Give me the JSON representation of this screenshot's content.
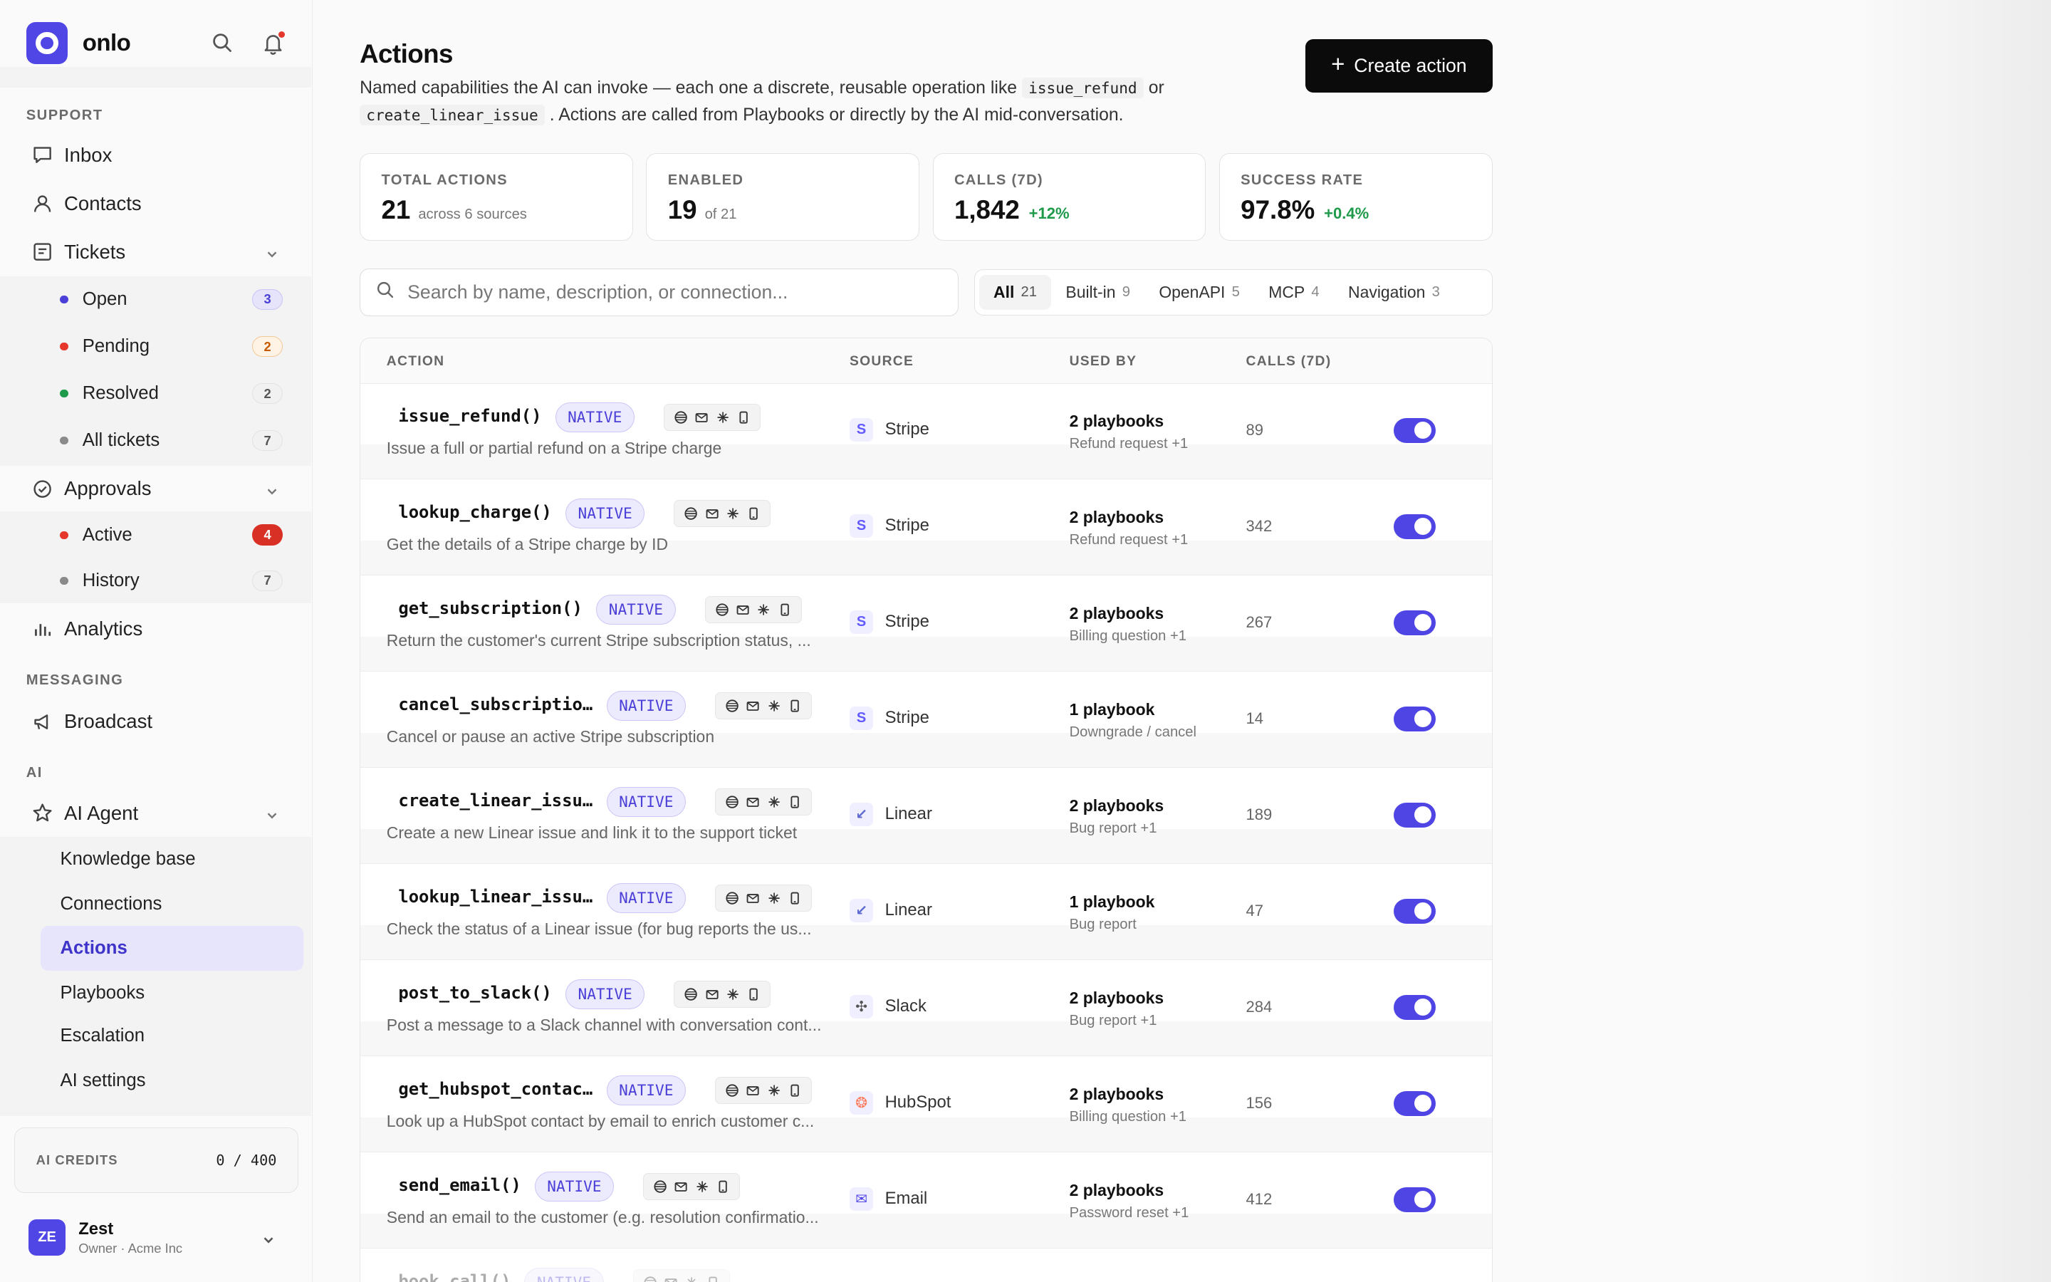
{
  "app": {
    "name": "onlo"
  },
  "sidebar": {
    "sections": {
      "support": "SUPPORT",
      "messaging": "MESSAGING",
      "ai": "AI"
    },
    "inbox": "Inbox",
    "contacts": "Contacts",
    "tickets": {
      "label": "Tickets",
      "items": [
        {
          "label": "Open",
          "count": "3",
          "dot": "#4a3fd6"
        },
        {
          "label": "Pending",
          "count": "2",
          "dot": "#e5372b"
        },
        {
          "label": "Resolved",
          "count": "2",
          "dot": "#1e9a4a"
        },
        {
          "label": "All tickets",
          "count": "7",
          "dot": "#8a8a8a"
        }
      ]
    },
    "approvals": {
      "label": "Approvals",
      "items": [
        {
          "label": "Active",
          "count": "4",
          "dot": "#e5372b"
        },
        {
          "label": "History",
          "count": "7",
          "dot": "#8a8a8a"
        }
      ]
    },
    "analytics": "Analytics",
    "broadcast": "Broadcast",
    "ai_agent": {
      "label": "AI Agent",
      "items": [
        "Knowledge base",
        "Connections",
        "Actions",
        "Playbooks",
        "Escalation",
        "AI settings"
      ],
      "active": "Actions"
    },
    "credits": {
      "label": "AI CREDITS",
      "value": "0 / 400"
    },
    "user": {
      "initials": "ZE",
      "name": "Zest",
      "role": "Owner · Acme Inc"
    }
  },
  "page": {
    "title": "Actions",
    "desc_1": "Named capabilities the AI can invoke — each one a discrete, reusable operation like",
    "code_1": "issue_refund",
    "desc_or": "or",
    "code_2": "create_linear_issue",
    "desc_2": ". Actions are called from Playbooks or directly by the AI mid-conversation.",
    "create_button": "Create action"
  },
  "stats": [
    {
      "label": "TOTAL ACTIONS",
      "value": "21",
      "sub": "across 6 sources",
      "delta": ""
    },
    {
      "label": "ENABLED",
      "value": "19",
      "sub": "of 21",
      "delta": ""
    },
    {
      "label": "CALLS (7D)",
      "value": "1,842",
      "sub": "",
      "delta": "+12%"
    },
    {
      "label": "SUCCESS RATE",
      "value": "97.8%",
      "sub": "",
      "delta": "+0.4%"
    }
  ],
  "search": {
    "placeholder": "Search by name, description, or connection..."
  },
  "filters": [
    {
      "label": "All",
      "count": "21"
    },
    {
      "label": "Built-in",
      "count": "9"
    },
    {
      "label": "OpenAPI",
      "count": "5"
    },
    {
      "label": "MCP",
      "count": "4"
    },
    {
      "label": "Navigation",
      "count": "3"
    }
  ],
  "table": {
    "columns": {
      "action": "ACTION",
      "source": "SOURCE",
      "used_by": "USED BY",
      "calls": "CALLS (7D)"
    },
    "rows": [
      {
        "name": "issue_refund()",
        "badge": "NATIVE",
        "desc": "Issue a full or partial refund on a Stripe charge",
        "source": "Stripe",
        "src_glyph": "S",
        "src_color": "#635bff",
        "used": "2 playbooks",
        "used_sub": "Refund request +1",
        "calls": "89",
        "enabled": true
      },
      {
        "name": "lookup_charge()",
        "badge": "NATIVE",
        "desc": "Get the details of a Stripe charge by ID",
        "source": "Stripe",
        "src_glyph": "S",
        "src_color": "#635bff",
        "used": "2 playbooks",
        "used_sub": "Refund request +1",
        "calls": "342",
        "enabled": true
      },
      {
        "name": "get_subscription()",
        "badge": "NATIVE",
        "desc": "Return the customer's current Stripe subscription status, ...",
        "source": "Stripe",
        "src_glyph": "S",
        "src_color": "#635bff",
        "used": "2 playbooks",
        "used_sub": "Billing question +1",
        "calls": "267",
        "enabled": true
      },
      {
        "name": "cancel_subscriptio…",
        "badge": "NATIVE",
        "desc": "Cancel or pause an active Stripe subscription",
        "source": "Stripe",
        "src_glyph": "S",
        "src_color": "#635bff",
        "used": "1 playbook",
        "used_sub": "Downgrade / cancel",
        "calls": "14",
        "enabled": true
      },
      {
        "name": "create_linear_issu…",
        "badge": "NATIVE",
        "desc": "Create a new Linear issue and link it to the support ticket",
        "source": "Linear",
        "src_glyph": "↙",
        "src_color": "#5e6ad2",
        "used": "2 playbooks",
        "used_sub": "Bug report +1",
        "calls": "189",
        "enabled": true
      },
      {
        "name": "lookup_linear_issu…",
        "badge": "NATIVE",
        "desc": "Check the status of a Linear issue (for bug reports the us...",
        "source": "Linear",
        "src_glyph": "↙",
        "src_color": "#5e6ad2",
        "used": "1 playbook",
        "used_sub": "Bug report",
        "calls": "47",
        "enabled": true
      },
      {
        "name": "post_to_slack()",
        "badge": "NATIVE",
        "desc": "Post a message to a Slack channel with conversation cont...",
        "source": "Slack",
        "src_glyph": "✣",
        "src_color": "#555555",
        "used": "2 playbooks",
        "used_sub": "Bug report +1",
        "calls": "284",
        "enabled": true
      },
      {
        "name": "get_hubspot_contac…",
        "badge": "NATIVE",
        "desc": "Look up a HubSpot contact by email to enrich customer c...",
        "source": "HubSpot",
        "src_glyph": "❂",
        "src_color": "#ff7a59",
        "used": "2 playbooks",
        "used_sub": "Billing question +1",
        "calls": "156",
        "enabled": true
      },
      {
        "name": "send_email()",
        "badge": "NATIVE",
        "desc": "Send an email to the customer (e.g. resolution confirmatio...",
        "source": "Email",
        "src_glyph": "✉",
        "src_color": "#5046e5",
        "used": "2 playbooks",
        "used_sub": "Password reset +1",
        "calls": "412",
        "enabled": true
      },
      {
        "name": "book_call()",
        "badge": "NATIVE",
        "desc": "",
        "source": "",
        "src_glyph": "",
        "src_color": "#5046e5",
        "used": "",
        "used_sub": "",
        "calls": "",
        "enabled": true
      }
    ]
  }
}
